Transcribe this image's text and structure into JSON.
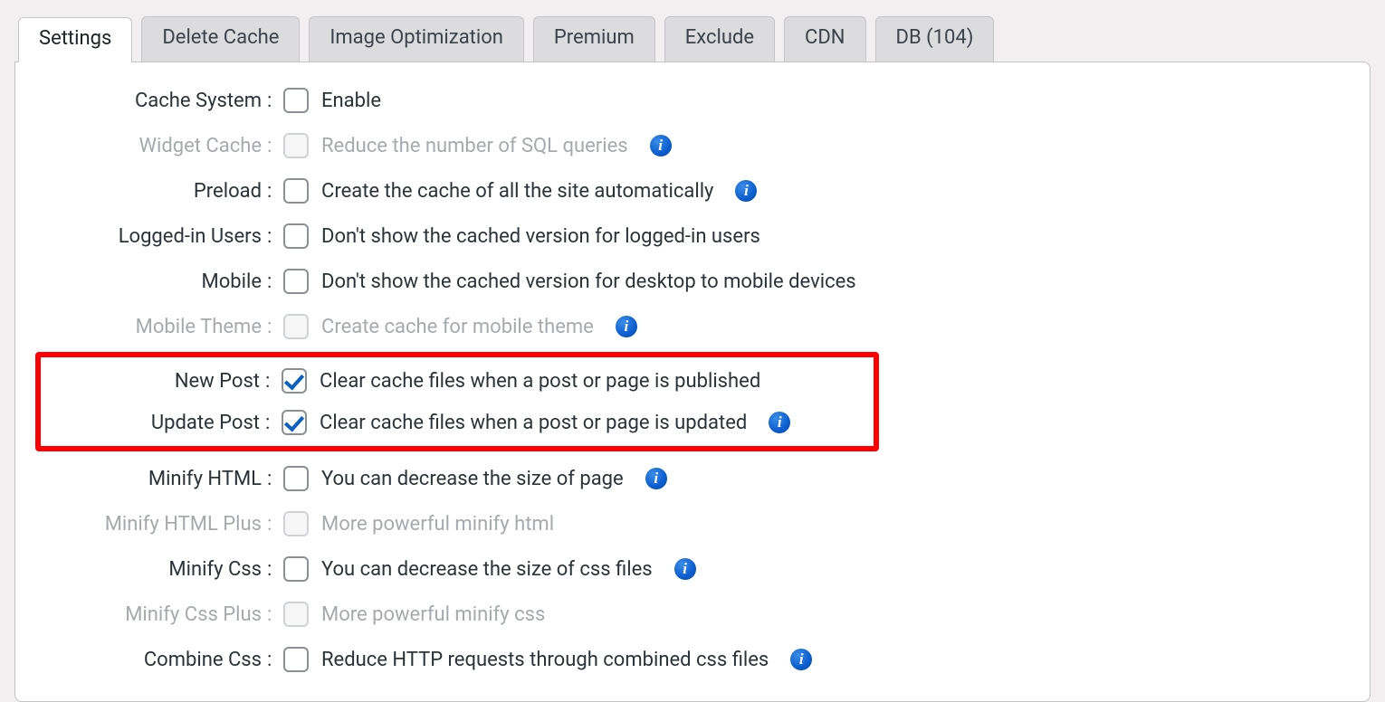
{
  "tabs": [
    {
      "label": "Settings",
      "active": true
    },
    {
      "label": "Delete Cache"
    },
    {
      "label": "Image Optimization"
    },
    {
      "label": "Premium"
    },
    {
      "label": "Exclude"
    },
    {
      "label": "CDN"
    },
    {
      "label": "DB (104)"
    }
  ],
  "options": [
    {
      "key": "cache_system",
      "label": "Cache System",
      "desc": "Enable",
      "checked": false,
      "disabled": false,
      "info": false
    },
    {
      "key": "widget_cache",
      "label": "Widget Cache",
      "desc": "Reduce the number of SQL queries",
      "checked": false,
      "disabled": true,
      "info": true
    },
    {
      "key": "preload",
      "label": "Preload",
      "desc": "Create the cache of all the site automatically",
      "checked": false,
      "disabled": false,
      "info": true
    },
    {
      "key": "logged_in_users",
      "label": "Logged-in Users",
      "desc": "Don't show the cached version for logged-in users",
      "checked": false,
      "disabled": false,
      "info": false
    },
    {
      "key": "mobile",
      "label": "Mobile",
      "desc": "Don't show the cached version for desktop to mobile devices",
      "checked": false,
      "disabled": false,
      "info": false
    },
    {
      "key": "mobile_theme",
      "label": "Mobile Theme",
      "desc": "Create cache for mobile theme",
      "checked": false,
      "disabled": true,
      "info": true
    },
    {
      "key": "new_post",
      "label": "New Post",
      "desc": "Clear cache files when a post or page is published",
      "checked": true,
      "disabled": false,
      "info": false
    },
    {
      "key": "update_post",
      "label": "Update Post",
      "desc": "Clear cache files when a post or page is updated",
      "checked": true,
      "disabled": false,
      "info": true
    },
    {
      "key": "minify_html",
      "label": "Minify HTML",
      "desc": "You can decrease the size of page",
      "checked": false,
      "disabled": false,
      "info": true
    },
    {
      "key": "minify_html_plus",
      "label": "Minify HTML Plus",
      "desc": "More powerful minify html",
      "checked": false,
      "disabled": true,
      "info": false
    },
    {
      "key": "minify_css",
      "label": "Minify Css",
      "desc": "You can decrease the size of css files",
      "checked": false,
      "disabled": false,
      "info": true
    },
    {
      "key": "minify_css_plus",
      "label": "Minify Css Plus",
      "desc": "More powerful minify css",
      "checked": false,
      "disabled": true,
      "info": false
    },
    {
      "key": "combine_css",
      "label": "Combine Css",
      "desc": "Reduce HTTP requests through combined css files",
      "checked": false,
      "disabled": false,
      "info": true
    }
  ],
  "highlight_keys": [
    "new_post",
    "update_post"
  ]
}
